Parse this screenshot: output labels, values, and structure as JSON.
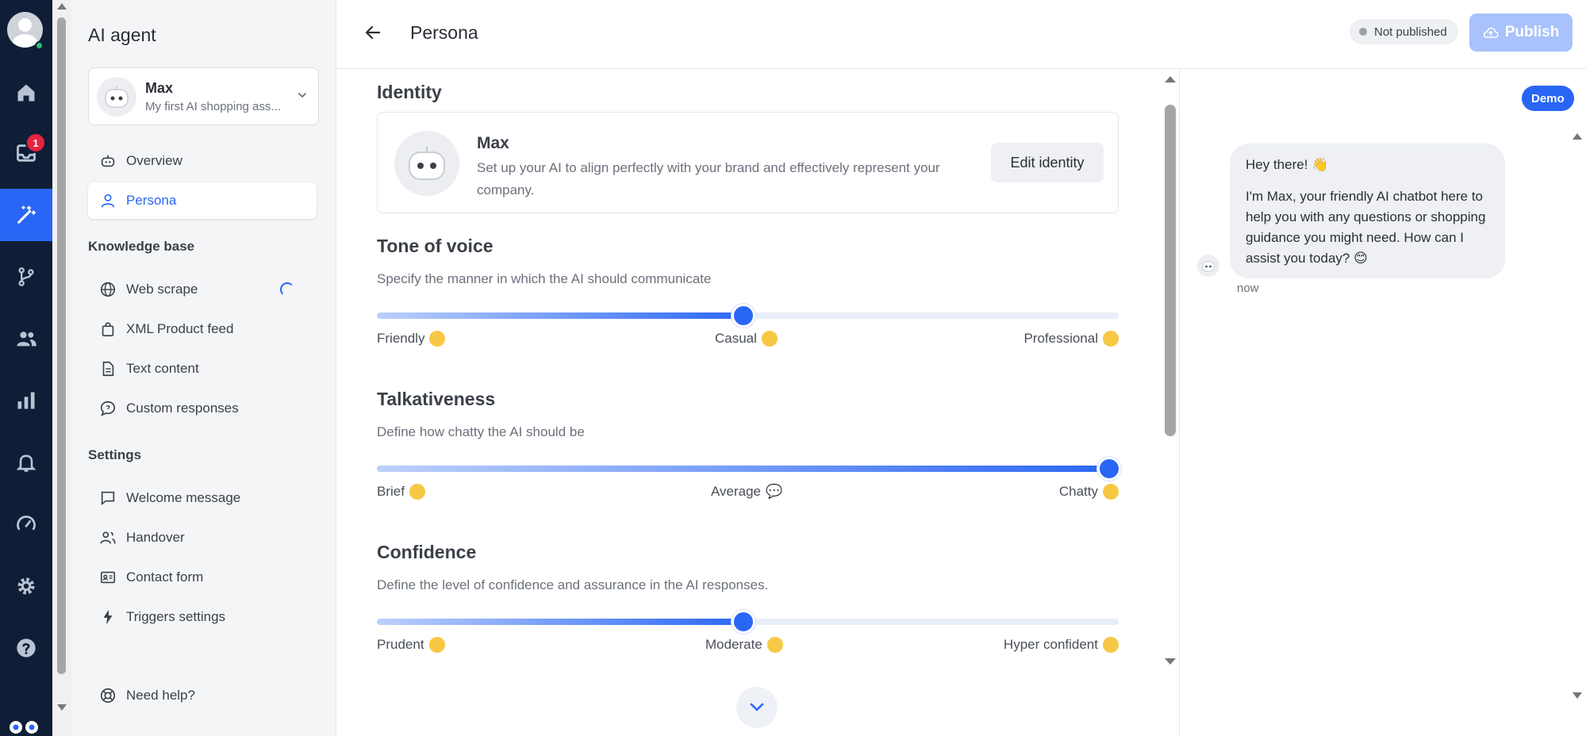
{
  "nav": {
    "title": "AI agent",
    "agent": {
      "name": "Max",
      "subtitle": "My first AI shopping ass..."
    },
    "items_top": [
      {
        "label": "Overview"
      },
      {
        "label": "Persona"
      }
    ],
    "knowledge_title": "Knowledge base",
    "knowledge_items": [
      {
        "label": "Web scrape"
      },
      {
        "label": "XML Product feed"
      },
      {
        "label": "Text content"
      },
      {
        "label": "Custom responses"
      }
    ],
    "settings_title": "Settings",
    "settings_items": [
      {
        "label": "Welcome message"
      },
      {
        "label": "Handover"
      },
      {
        "label": "Contact form"
      },
      {
        "label": "Triggers settings"
      }
    ],
    "help": "Need help?"
  },
  "rail": {
    "inbox_badge": "1"
  },
  "header": {
    "title": "Persona",
    "status": "Not published",
    "publish": "Publish"
  },
  "identity": {
    "title": "Identity",
    "name": "Max",
    "description": "Set up your AI to align perfectly with your brand and effectively represent your company.",
    "edit": "Edit identity"
  },
  "tone": {
    "title": "Tone of voice",
    "description": "Specify the manner in which the AI should communicate",
    "value": 0.5,
    "labels": [
      "Friendly",
      "Casual",
      "Professional"
    ]
  },
  "talk": {
    "title": "Talkativeness",
    "description": "Define how chatty the AI should be",
    "value": 1.0,
    "labels": [
      "Brief",
      "Average",
      "Chatty"
    ]
  },
  "confidence": {
    "title": "Confidence",
    "description": "Define the level of confidence and assurance in the AI responses.",
    "value": 0.5,
    "labels": [
      "Prudent",
      "Moderate",
      "Hyper confident"
    ]
  },
  "preview": {
    "demo": "Demo",
    "greeting": "Hey there! 👋",
    "message": "I'm Max, your friendly AI chatbot here to help you with any questions or shopping guidance you might need. How can I assist you today? 😊",
    "time": "now"
  },
  "colors": {
    "accent": "#2a66f5",
    "rail": "#0f1e36",
    "badge": "#e5233f"
  }
}
